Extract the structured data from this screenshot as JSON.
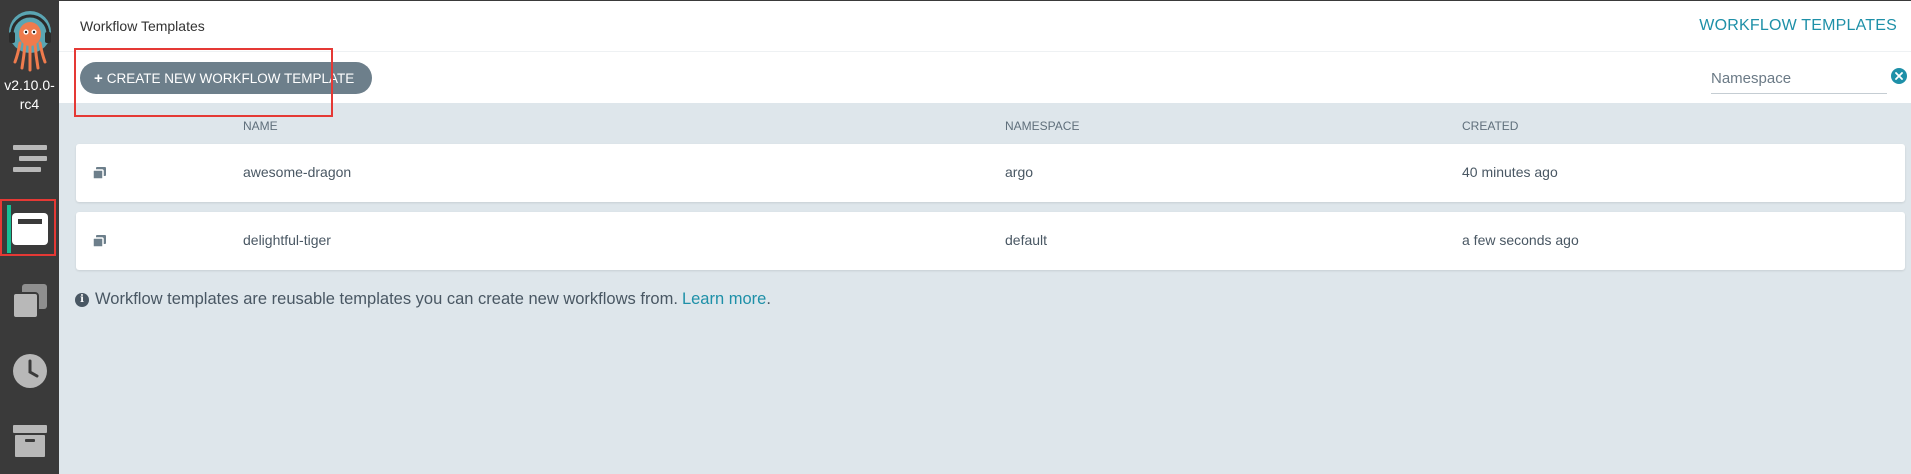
{
  "sidebar": {
    "version": "v2.10.0-rc4",
    "items": [
      {
        "name": "workflows",
        "icon": "stream-icon"
      },
      {
        "name": "workflow-templates",
        "icon": "window-icon",
        "active": true
      },
      {
        "name": "cluster-workflow-templates",
        "icon": "clone-icon"
      },
      {
        "name": "cron-workflows",
        "icon": "clock-icon"
      },
      {
        "name": "archived-workflows",
        "icon": "archive-icon"
      }
    ]
  },
  "topbar": {
    "title": "Workflow Templates",
    "section_label": "WORKFLOW TEMPLATES"
  },
  "toolbar": {
    "create_label": "CREATE NEW WORKFLOW TEMPLATE",
    "namespace_placeholder": "Namespace"
  },
  "table": {
    "columns": [
      "NAME",
      "NAMESPACE",
      "CREATED"
    ],
    "rows": [
      {
        "name": "awesome-dragon",
        "namespace": "argo",
        "created": "40 minutes ago"
      },
      {
        "name": "delightful-tiger",
        "namespace": "default",
        "created": "a few seconds ago"
      }
    ]
  },
  "info": {
    "text": "Workflow templates are reusable templates you can create new workflows from.",
    "link": "Learn more",
    "suffix": "."
  },
  "colors": {
    "sidebar_bg": "#3a3a3a",
    "accent_teal": "#1e90a8",
    "active_indicator": "#18be94",
    "button_bg": "#6d7f8b",
    "page_bg": "#dee6eb",
    "highlight": "#e53935"
  }
}
